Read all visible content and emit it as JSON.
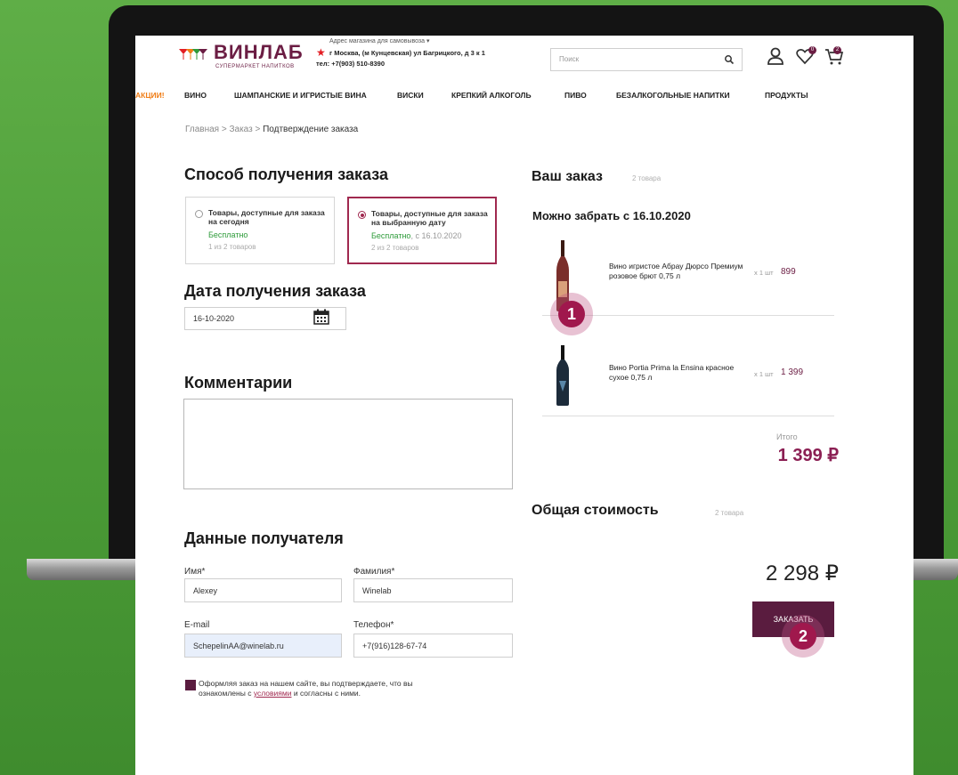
{
  "header": {
    "logo_text": "ВИНЛАБ",
    "logo_subtitle": "СУПЕРМАРКЕТ НАПИТКОВ",
    "pickup_address_label": "Адрес магазина для самовывоза ▾",
    "pickup_address": "г Москва, (м Кунцевская) ул Багрицкого, д 3 к 1",
    "phone": "тел: +7(903) 510-8390",
    "search_placeholder": "Поиск",
    "favorites_count": "0",
    "cart_count": "2"
  },
  "nav": {
    "items": [
      {
        "label": "АКЦИИ!",
        "accent": true
      },
      {
        "label": "ВИНО"
      },
      {
        "label": "ШАМПАНСКИЕ И ИГРИСТЫЕ ВИНА"
      },
      {
        "label": "ВИСКИ"
      },
      {
        "label": "КРЕПКИЙ АЛКОГОЛЬ"
      },
      {
        "label": "ПИВО"
      },
      {
        "label": "БЕЗАЛКОГОЛЬНЫЕ НАПИТКИ"
      },
      {
        "label": "ПРОДУКТЫ"
      }
    ]
  },
  "breadcrumb": {
    "home": "Главная",
    "order": "Заказ",
    "current": "Подтверждение заказа",
    "separator": ">"
  },
  "delivery": {
    "title": "Способ получения заказа",
    "options": [
      {
        "title": "Товары, доступные для заказа на сегодня",
        "price": "Бесплатно",
        "date": "",
        "count": "1 из 2 товаров",
        "selected": false
      },
      {
        "title": "Товары, доступные для заказа на выбранную дату",
        "price": "Бесплатно",
        "date": ", с 16.10.2020",
        "count": "2 из 2 товаров",
        "selected": true
      }
    ]
  },
  "date_section": {
    "title": "Дата получения заказа",
    "value": "16-10-2020"
  },
  "comments": {
    "title": "Комментарии",
    "value": ""
  },
  "recipient": {
    "title": "Данные получателя",
    "first_name_label": "Имя*",
    "first_name": "Alexey",
    "last_name_label": "Фамилия*",
    "last_name": "Winelab",
    "email_label": "E-mail",
    "email": "SchepelinAA@winelab.ru",
    "phone_label": "Телефон*",
    "phone": "+7(916)128-67-74"
  },
  "consent": {
    "text_before": "Оформляя заказ на нашем сайте, вы подтверждаете, что вы ознакомлены с ",
    "link": "условиями",
    "text_after": " и согласны с ними."
  },
  "order": {
    "title": "Ваш заказ",
    "count": "2 товара",
    "pickup_from": "Можно забрать с 16.10.2020",
    "items": [
      {
        "name": "Вино игристое Абрау Дюрсо Премиум розовое брют 0,75 л",
        "qty": "x 1 шт",
        "price": "899",
        "bottle_color": "#7a2e2a"
      },
      {
        "name": "Вино Portia Prima la Ensina красное сухое 0,75 л",
        "qty": "x 1 шт",
        "price": "1 399",
        "bottle_color": "#1c2b3a"
      }
    ],
    "subtotal_label": "Итого",
    "subtotal": "1 399 ₽"
  },
  "summary": {
    "title": "Общая стоимость",
    "count": "2 товара",
    "total": "2 298 ₽",
    "order_button": "ЗАКАЗАТЬ"
  },
  "steps": [
    "1",
    "2"
  ],
  "colors": {
    "brand": "#6b1d43",
    "accent_orange": "#f07d16",
    "free_green": "#2e9b3a",
    "step_marker": "#a0184d",
    "background_green": "#4a9a36"
  }
}
